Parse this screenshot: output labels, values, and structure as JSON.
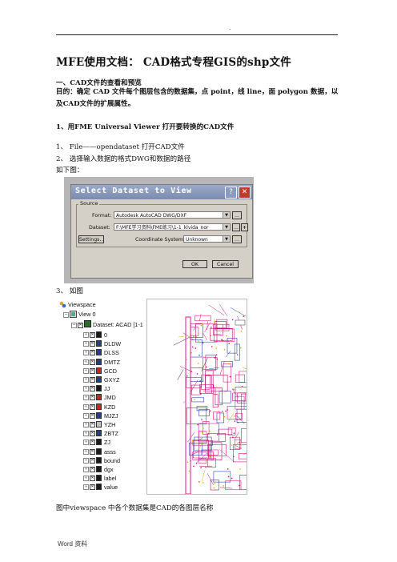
{
  "header_mark": ".",
  "title": "MFE使用文档： CAD格式专程GIS的shp文件",
  "section1": {
    "heading": "一、CAD文件的查看和预览",
    "body": "目的：确定 CAD 文件每个图层包含的数据集，点 point，线 line，面 polygon 数据，以及CAD文件的扩展属性。"
  },
  "section2": {
    "heading": "1、用FME Universal Viewer 打开要转换的CAD文件",
    "steps": [
      "1、  File——opendataset 打开CAD文件",
      "2、  选择输入数据的格式DWG和数据的路径"
    ],
    "caption_before_dialog": "如下图：",
    "step3": "3、  如图"
  },
  "dialog": {
    "title": "Select Dataset to View",
    "help_btn": "?",
    "close_btn": "✕",
    "group": "Source",
    "format_label": "Format:",
    "format_value": "Autodesk AutoCAD DWG/DXF",
    "dataset_label": "Dataset:",
    "dataset_value": "F:\\MFE学习资料\\FME练习\\1-1_klvida_nor",
    "settings_btn": "Settings...",
    "coord_label": "Coordinate System:",
    "coord_value": "Unknown",
    "ok_btn": "OK",
    "cancel_btn": "Cancel",
    "ellipsis": "...",
    "plus": "+"
  },
  "tree": {
    "root": "Viewspace",
    "view": "View 0",
    "dataset": "Dataset: ACAD [1-1",
    "layers": [
      {
        "name": "0",
        "color": "#1a1a1a"
      },
      {
        "name": "DLDW",
        "color": "#2a3a8a"
      },
      {
        "name": "DLSS",
        "color": "#2a3a8a"
      },
      {
        "name": "DMTZ",
        "color": "#2a3a8a"
      },
      {
        "name": "GCD",
        "color": "#cc2222"
      },
      {
        "name": "GXYZ",
        "color": "#2a3a8a"
      },
      {
        "name": "JJ",
        "color": "#1a1a1a"
      },
      {
        "name": "JMD",
        "color": "#cc2222"
      },
      {
        "name": "KZD",
        "color": "#cc2222"
      },
      {
        "name": "MJZJ",
        "color": "#2a3a8a"
      },
      {
        "name": "YZH",
        "color": "#c0c0c0"
      },
      {
        "name": "ZBTZ",
        "color": "#2a3a8a"
      },
      {
        "name": "ZJ",
        "color": "#1a1a1a"
      },
      {
        "name": "asss",
        "color": "#1a1a1a"
      },
      {
        "name": "bound",
        "color": "#1a1a1a"
      },
      {
        "name": "dgx",
        "color": "#1a1a1a"
      },
      {
        "name": "label",
        "color": "#1a1a1a"
      },
      {
        "name": "value",
        "color": "#1a1a1a"
      }
    ]
  },
  "caption_after_tree": "图中viewspace 中各个数据集是CAD的各图层名称",
  "footer": "Word 资料"
}
